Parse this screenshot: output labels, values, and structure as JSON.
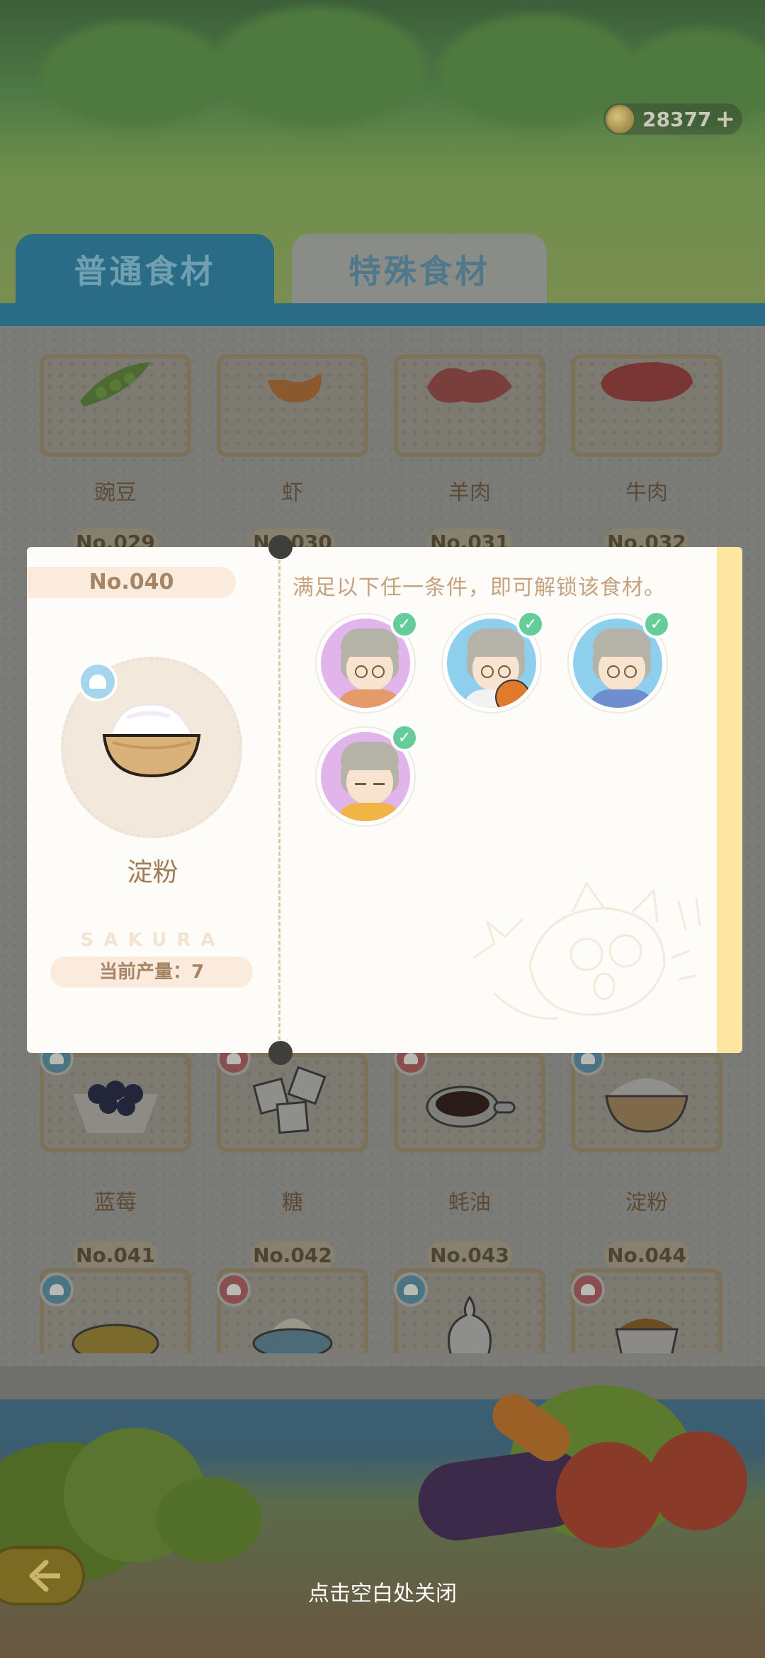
{
  "currency": {
    "value": "28377",
    "icon": "coin-icon",
    "add_icon": "plus-icon"
  },
  "tabs": [
    {
      "label": "普通食材",
      "active": true
    },
    {
      "label": "特殊食材",
      "active": false
    }
  ],
  "grid": {
    "row1": [
      {
        "name": "豌豆",
        "no": "No.029"
      },
      {
        "name": "虾",
        "no": "No.030"
      },
      {
        "name": "羊肉",
        "no": "No.031"
      },
      {
        "name": "牛肉",
        "no": "No.032"
      }
    ],
    "row2": [
      {
        "name": "蓝莓"
      },
      {
        "name": "糖"
      },
      {
        "name": "蚝油"
      },
      {
        "name": "淀粉"
      }
    ],
    "row3": [
      {
        "no": "No.041"
      },
      {
        "no": "No.042"
      },
      {
        "no": "No.043"
      },
      {
        "no": "No.044"
      }
    ]
  },
  "dialog": {
    "no": "No.040",
    "ingredient_name": "淀粉",
    "watermark": "SAKURA",
    "output_label": "当前产量：7",
    "condition_text": "满足以下任一条件，即可解锁该食材。",
    "conditions": [
      {
        "avatar": "character-avatar",
        "met": true,
        "bg": "#e2b4ec"
      },
      {
        "avatar": "character-avatar",
        "met": true,
        "bg": "#8fcfee"
      },
      {
        "avatar": "character-avatar",
        "met": true,
        "bg": "#8fcfee"
      },
      {
        "avatar": "character-avatar",
        "met": true,
        "bg": "#e2b4ec"
      }
    ]
  },
  "hint": "点击空白处关闭",
  "colors": {
    "accent": "#2a6c86",
    "check": "#66cc99",
    "dialog_band": "#fde7a3"
  }
}
